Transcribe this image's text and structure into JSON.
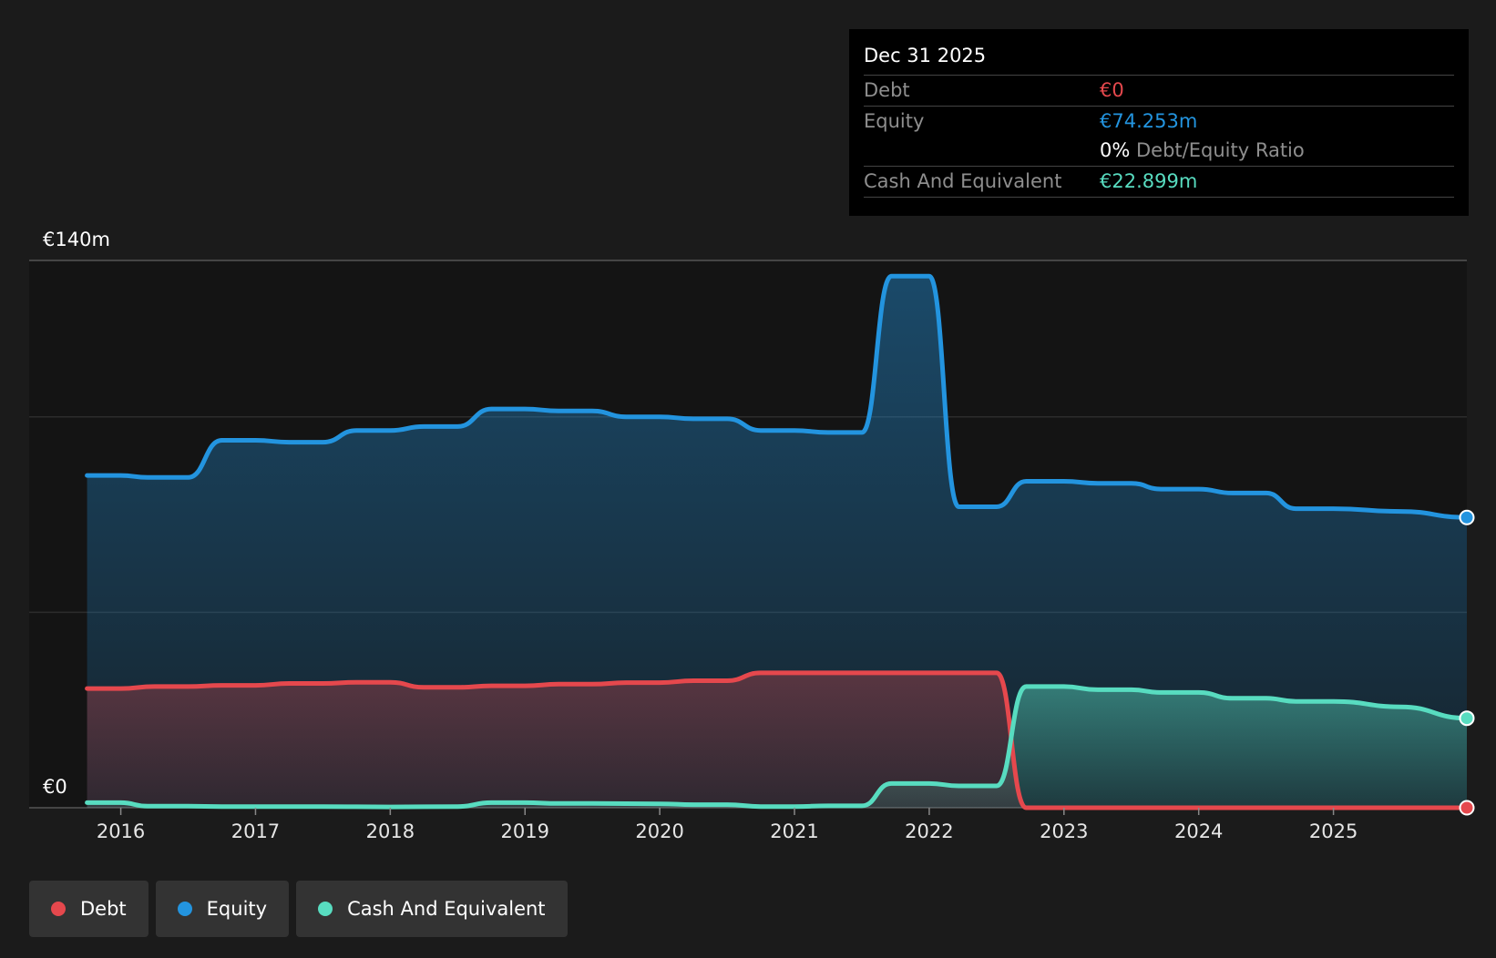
{
  "colors": {
    "debt": "#e5484d",
    "equity": "#2394df",
    "cash": "#58dcc0",
    "background": "#1b1b1b",
    "plot_background": "#141414"
  },
  "tooltip": {
    "date": "Dec 31 2025",
    "debt_label": "Debt",
    "debt_value": "€0",
    "equity_label": "Equity",
    "equity_value": "€74.253m",
    "ratio_value": "0%",
    "ratio_label": "Debt/Equity Ratio",
    "cash_label": "Cash And Equivalent",
    "cash_value": "€22.899m"
  },
  "legend": [
    {
      "label": "Debt",
      "color": "#e5484d"
    },
    {
      "label": "Equity",
      "color": "#2394df"
    },
    {
      "label": "Cash And Equivalent",
      "color": "#58dcc0"
    }
  ],
  "chart_data": {
    "type": "area",
    "title": "",
    "xlabel": "",
    "ylabel": "",
    "ylim": [
      0,
      140
    ],
    "xlim": [
      2015.32,
      2025.99
    ],
    "y_tick_labels": [
      {
        "value": 140,
        "label": "€140m"
      },
      {
        "value": 0,
        "label": "€0"
      }
    ],
    "gridlines": [
      140,
      100,
      50,
      0
    ],
    "x_ticks": [
      {
        "value": 2016,
        "label": "2016"
      },
      {
        "value": 2017,
        "label": "2017"
      },
      {
        "value": 2018,
        "label": "2018"
      },
      {
        "value": 2019,
        "label": "2019"
      },
      {
        "value": 2020,
        "label": "2020"
      },
      {
        "value": 2021,
        "label": "2021"
      },
      {
        "value": 2022,
        "label": "2022"
      },
      {
        "value": 2023,
        "label": "2023"
      },
      {
        "value": 2024,
        "label": "2024"
      },
      {
        "value": 2025,
        "label": "2025"
      }
    ],
    "series": [
      {
        "name": "Equity",
        "color": "#2394df",
        "points": [
          [
            2015.75,
            85
          ],
          [
            2016.0,
            85
          ],
          [
            2016.2,
            84.5
          ],
          [
            2016.5,
            84.5
          ],
          [
            2016.75,
            94
          ],
          [
            2017.0,
            94
          ],
          [
            2017.25,
            93.5
          ],
          [
            2017.5,
            93.5
          ],
          [
            2017.75,
            96.5
          ],
          [
            2018.0,
            96.5
          ],
          [
            2018.25,
            97.5
          ],
          [
            2018.5,
            97.5
          ],
          [
            2018.75,
            102
          ],
          [
            2019.0,
            102
          ],
          [
            2019.25,
            101.5
          ],
          [
            2019.5,
            101.5
          ],
          [
            2019.75,
            100
          ],
          [
            2020.0,
            100
          ],
          [
            2020.25,
            99.5
          ],
          [
            2020.5,
            99.5
          ],
          [
            2020.75,
            96.5
          ],
          [
            2021.0,
            96.5
          ],
          [
            2021.25,
            96
          ],
          [
            2021.5,
            96
          ],
          [
            2021.72,
            136
          ],
          [
            2022.0,
            136
          ],
          [
            2022.22,
            77
          ],
          [
            2022.5,
            77
          ],
          [
            2022.72,
            83.5
          ],
          [
            2023.0,
            83.5
          ],
          [
            2023.25,
            83
          ],
          [
            2023.5,
            83
          ],
          [
            2023.72,
            81.5
          ],
          [
            2024.0,
            81.5
          ],
          [
            2024.25,
            80.5
          ],
          [
            2024.5,
            80.5
          ],
          [
            2024.72,
            76.5
          ],
          [
            2025.0,
            76.5
          ],
          [
            2025.5,
            75.8
          ],
          [
            2025.99,
            74.253
          ]
        ]
      },
      {
        "name": "Debt",
        "color": "#e5484d",
        "points": [
          [
            2015.75,
            30.5
          ],
          [
            2016.0,
            30.5
          ],
          [
            2016.25,
            31
          ],
          [
            2016.5,
            31
          ],
          [
            2016.75,
            31.3
          ],
          [
            2017.0,
            31.3
          ],
          [
            2017.25,
            31.8
          ],
          [
            2017.5,
            31.8
          ],
          [
            2017.75,
            32.1
          ],
          [
            2018.0,
            32.1
          ],
          [
            2018.25,
            30.8
          ],
          [
            2018.5,
            30.8
          ],
          [
            2018.75,
            31.2
          ],
          [
            2019.0,
            31.2
          ],
          [
            2019.25,
            31.6
          ],
          [
            2019.5,
            31.6
          ],
          [
            2019.75,
            32
          ],
          [
            2020.0,
            32
          ],
          [
            2020.25,
            32.5
          ],
          [
            2020.5,
            32.5
          ],
          [
            2020.75,
            34.5
          ],
          [
            2021.0,
            34.5
          ],
          [
            2021.5,
            34.5
          ],
          [
            2022.0,
            34.5
          ],
          [
            2022.5,
            34.5
          ],
          [
            2022.72,
            0
          ],
          [
            2023.0,
            0
          ],
          [
            2024.0,
            0
          ],
          [
            2025.0,
            0
          ],
          [
            2025.99,
            0
          ]
        ]
      },
      {
        "name": "Cash And Equivalent",
        "color": "#58dcc0",
        "points": [
          [
            2015.75,
            1.3
          ],
          [
            2016.0,
            1.3
          ],
          [
            2016.2,
            0.4
          ],
          [
            2016.5,
            0.4
          ],
          [
            2016.75,
            0.3
          ],
          [
            2017.0,
            0.3
          ],
          [
            2017.5,
            0.3
          ],
          [
            2018.0,
            0.2
          ],
          [
            2018.5,
            0.3
          ],
          [
            2018.75,
            1.3
          ],
          [
            2019.0,
            1.3
          ],
          [
            2019.25,
            1.1
          ],
          [
            2019.5,
            1.1
          ],
          [
            2020.0,
            1.0
          ],
          [
            2020.25,
            0.8
          ],
          [
            2020.5,
            0.8
          ],
          [
            2020.75,
            0.3
          ],
          [
            2021.0,
            0.3
          ],
          [
            2021.25,
            0.5
          ],
          [
            2021.5,
            0.5
          ],
          [
            2021.72,
            6.2
          ],
          [
            2022.0,
            6.2
          ],
          [
            2022.22,
            5.6
          ],
          [
            2022.5,
            5.6
          ],
          [
            2022.72,
            31
          ],
          [
            2023.0,
            31
          ],
          [
            2023.25,
            30.2
          ],
          [
            2023.5,
            30.2
          ],
          [
            2023.72,
            29.5
          ],
          [
            2024.0,
            29.5
          ],
          [
            2024.25,
            28
          ],
          [
            2024.5,
            28
          ],
          [
            2024.72,
            27.2
          ],
          [
            2025.0,
            27.2
          ],
          [
            2025.5,
            25.8
          ],
          [
            2025.99,
            22.899
          ]
        ]
      }
    ]
  }
}
